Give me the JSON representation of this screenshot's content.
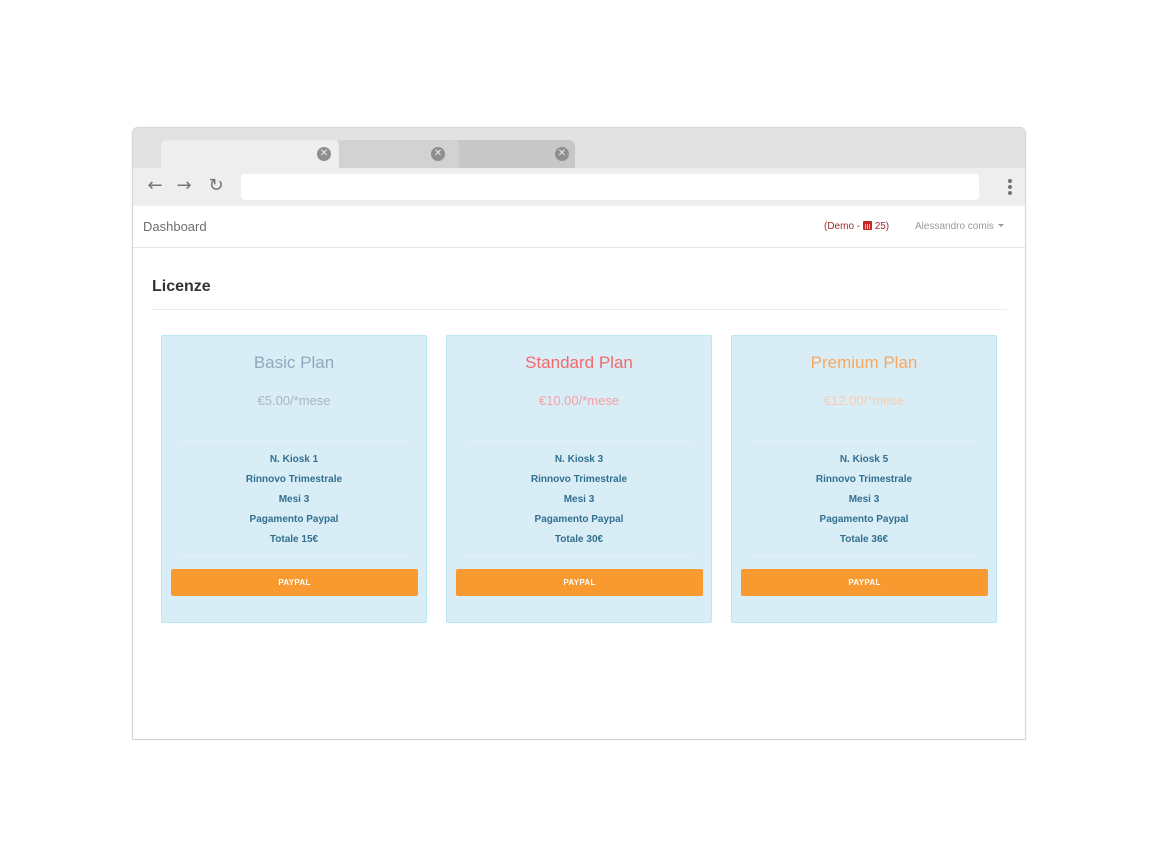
{
  "browser": {
    "tabs": [
      {
        "close_glyph": "✕"
      },
      {
        "close_glyph": "✕"
      },
      {
        "close_glyph": "✕"
      }
    ],
    "toolbar": {
      "back_icon": "←",
      "forward_icon": "→",
      "reload_icon": "↻",
      "address_value": "",
      "menu_icon": "kebab-menu-icon"
    }
  },
  "app": {
    "brand": "Dashboard",
    "demo_prefix": "(Demo - ",
    "demo_days": "25)",
    "user_name": "Alessandro comis"
  },
  "page": {
    "title": "Licenze"
  },
  "plans": [
    {
      "name": "Basic Plan",
      "price": "€5.00/*mese",
      "name_color": "#8fa9bd",
      "price_color": "#aab7c0",
      "features": [
        "N. Kiosk 1",
        "Rinnovo Trimestrale",
        "Mesi 3",
        "Pagamento Paypal",
        "Totale 15€"
      ],
      "button": "PAYPAL"
    },
    {
      "name": "Standard Plan",
      "price": "€10.00/*mese",
      "name_color": "#f26a6a",
      "price_color": "#f3a2a8",
      "features": [
        "N. Kiosk 3",
        "Rinnovo Trimestrale",
        "Mesi 3",
        "Pagamento Paypal",
        "Totale 30€"
      ],
      "button": "PAYPAL"
    },
    {
      "name": "Premium Plan",
      "price": "€12.00/*mese",
      "name_color": "#f9a860",
      "price_color": "#f8ccae",
      "features": [
        "N. Kiosk 5",
        "Rinnovo Trimestrale",
        "Mesi 3",
        "Pagamento Paypal",
        "Totale 36€"
      ],
      "button": "PAYPAL"
    }
  ]
}
